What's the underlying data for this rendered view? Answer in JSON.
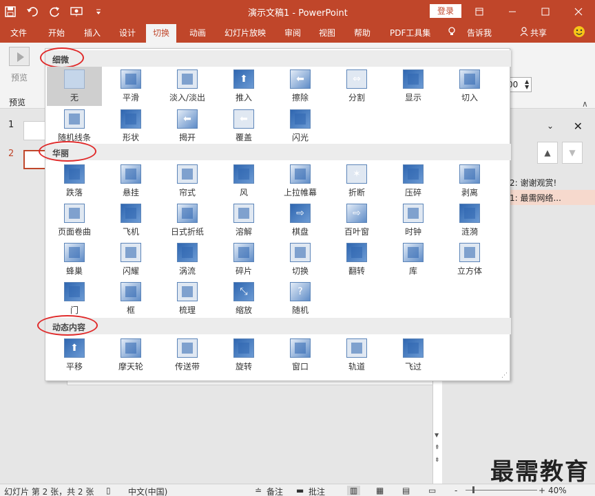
{
  "window": {
    "title": "演示文稿1  -  PowerPoint",
    "login_label": "登录"
  },
  "tabs": [
    "文件",
    "开始",
    "插入",
    "设计",
    "切换",
    "动画",
    "幻灯片放映",
    "审阅",
    "视图",
    "帮助",
    "PDF工具集",
    "告诉我",
    "共享"
  ],
  "active_tab": "切换",
  "ribbon": {
    "preview_label": "预览",
    "group_label": "预览",
    "duration_value": "00"
  },
  "slides": [
    {
      "number": "1"
    },
    {
      "number": "2"
    }
  ],
  "right_pane": {
    "rows": [
      "2: 谢谢观赏!",
      "1: 最需网络..."
    ]
  },
  "gallery": {
    "sections": [
      {
        "title": "细微",
        "items": [
          "无",
          "平滑",
          "淡入/淡出",
          "推入",
          "擦除",
          "分割",
          "显示",
          "切入",
          "随机线条",
          "形状",
          "揭开",
          "覆盖",
          "闪光"
        ]
      },
      {
        "title": "华丽",
        "items": [
          "跌落",
          "悬挂",
          "帘式",
          "风",
          "上拉帷幕",
          "折断",
          "压碎",
          "剥离",
          "页面卷曲",
          "飞机",
          "日式折纸",
          "溶解",
          "棋盘",
          "百叶窗",
          "时钟",
          "涟漪",
          "蜂巢",
          "闪耀",
          "涡流",
          "碎片",
          "切换",
          "翻转",
          "库",
          "立方体",
          "门",
          "框",
          "梳理",
          "缩放",
          "随机"
        ]
      },
      {
        "title": "动态内容",
        "items": [
          "平移",
          "摩天轮",
          "传送带",
          "旋转",
          "窗口",
          "轨道",
          "飞过"
        ]
      }
    ],
    "selected": "无"
  },
  "status": {
    "slide_info": "幻灯片 第 2 张，共 2 张",
    "language": "中文(中国)",
    "notes": "备注",
    "comments": "批注",
    "zoom": "40%",
    "zoom_minus": "-",
    "zoom_plus": "+"
  },
  "watermark": "最需教育",
  "colors": {
    "accent": "#c0462a",
    "icon_blue": "#2f66b0"
  }
}
